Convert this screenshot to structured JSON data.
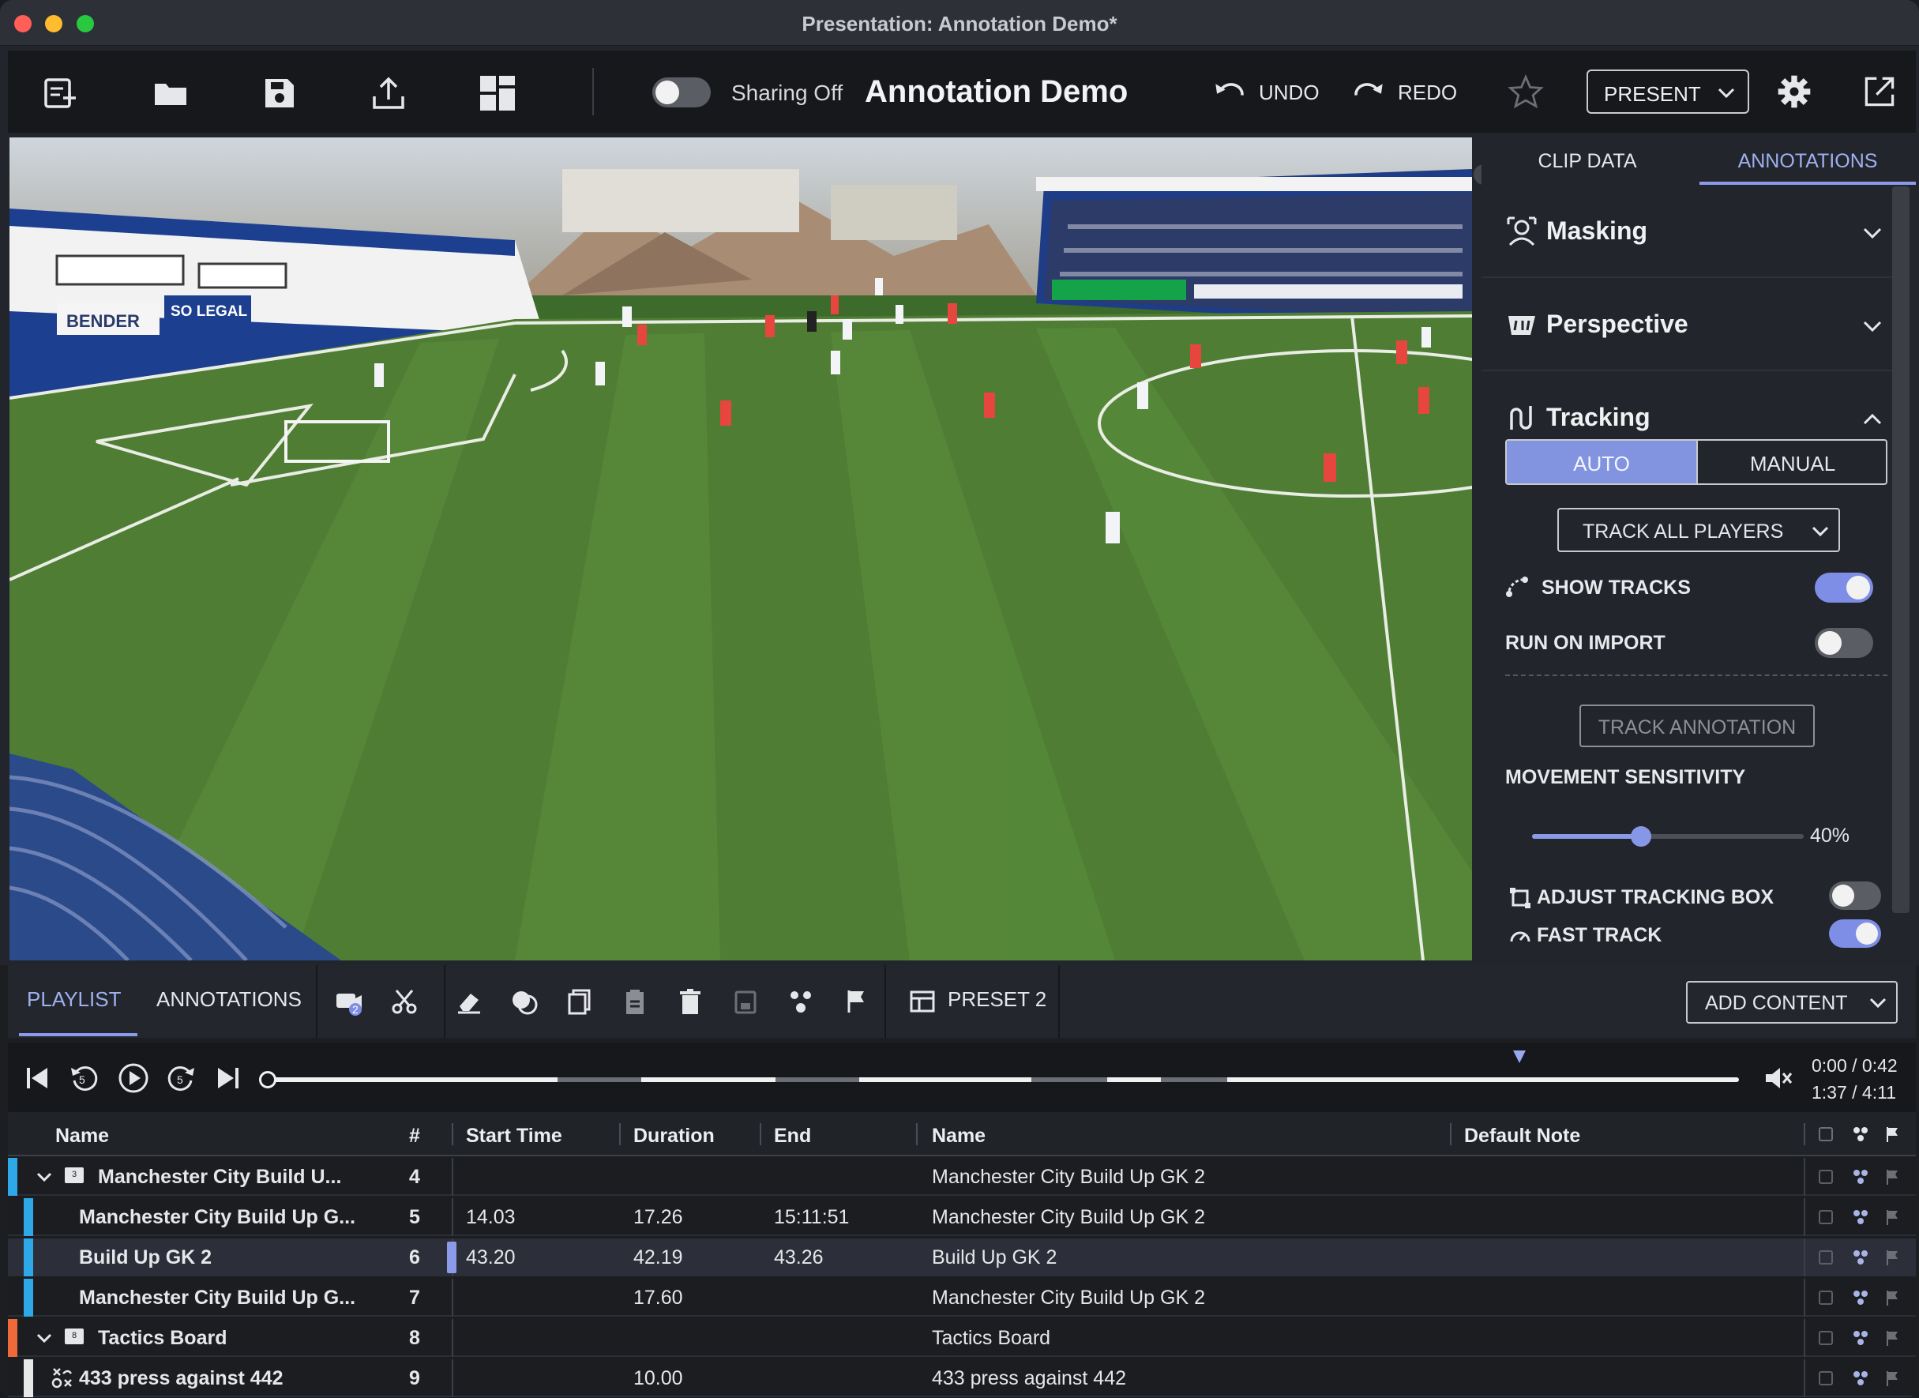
{
  "window": {
    "title": "Presentation: Annotation Demo*"
  },
  "toolbar": {
    "sharing_label": "Sharing Off",
    "document_title": "Annotation Demo",
    "undo_label": "UNDO",
    "redo_label": "REDO",
    "present_label": "PRESENT",
    "icons": [
      "new-presentation-icon",
      "open-folder-icon",
      "save-icon",
      "export-icon",
      "layout-grid-icon",
      "star-icon",
      "settings-gear-icon",
      "popout-icon"
    ],
    "sharing_on": false
  },
  "video": {
    "banner_left_1": "BENDER",
    "banner_left_2": "SO LEGAL"
  },
  "right_panel": {
    "tabs": [
      "CLIP DATA",
      "ANNOTATIONS"
    ],
    "active_tab": "ANNOTATIONS",
    "sections": {
      "masking": "Masking",
      "perspective": "Perspective",
      "tracking": "Tracking"
    },
    "tracking": {
      "mode_auto": "AUTO",
      "mode_manual": "MANUAL",
      "selected_mode": "AUTO",
      "track_dropdown": "TRACK ALL PLAYERS",
      "show_tracks_label": "SHOW TRACKS",
      "show_tracks_on": true,
      "run_on_import_label": "RUN ON IMPORT",
      "run_on_import_on": false,
      "track_annotation_label": "TRACK ANNOTATION",
      "movement_sensitivity_label": "MOVEMENT SENSITIVITY",
      "movement_sensitivity_value": 0.4,
      "movement_sensitivity_text": "40%",
      "adjust_tracking_box_label": "ADJUST TRACKING BOX",
      "adjust_tracking_box_on": false,
      "fast_track_label": "FAST TRACK",
      "fast_track_on": true
    }
  },
  "bottom_panel": {
    "tabs": [
      "PLAYLIST",
      "ANNOTATIONS"
    ],
    "active_tab": "PLAYLIST",
    "clip_badge_count": "2",
    "preset_label": "PRESET 2",
    "add_content_label": "ADD CONTENT",
    "time_current_clip": "0:00 / 0:42",
    "time_total": "1:37 / 4:11",
    "playhead_fraction": 0.0
  },
  "table": {
    "headers": {
      "name": "Name",
      "num": "#",
      "start": "Start Time",
      "duration": "Duration",
      "end": "End",
      "clip_name": "Name",
      "default_note": "Default Note"
    },
    "rows": [
      {
        "name": "Manchester City Build U...",
        "num": "4",
        "start": "",
        "duration": "",
        "end": "",
        "clip_name": "Manchester City Build Up GK 2",
        "group": true,
        "group_count": "3",
        "color": "#2ea8e6"
      },
      {
        "name": "Manchester City Build Up G...",
        "num": "5",
        "start": "14.03",
        "duration": "17.26",
        "end": "15:11:51",
        "clip_name": "Manchester City Build Up GK 2",
        "group": false,
        "color": "#2ea8e6"
      },
      {
        "name": "Build Up GK 2",
        "num": "6",
        "start": "43.20",
        "duration": "42.19",
        "end": "43.26",
        "clip_name": "Build Up GK 2",
        "group": false,
        "color": "#2ea8e6",
        "selected": true
      },
      {
        "name": "Manchester City Build Up G...",
        "num": "7",
        "start": "",
        "duration": "17.60",
        "end": "",
        "clip_name": "Manchester City Build Up GK 2",
        "group": false,
        "color": "#2ea8e6"
      },
      {
        "name": "Tactics Board",
        "num": "8",
        "start": "",
        "duration": "",
        "end": "",
        "clip_name": "Tactics Board",
        "group": true,
        "group_count": "8",
        "color": "#ee6a3a"
      },
      {
        "name": "433 press against 442",
        "num": "9",
        "start": "",
        "duration": "10.00",
        "end": "",
        "clip_name": "433 press against 442",
        "group": false,
        "color": "#e8e8e8"
      }
    ]
  }
}
